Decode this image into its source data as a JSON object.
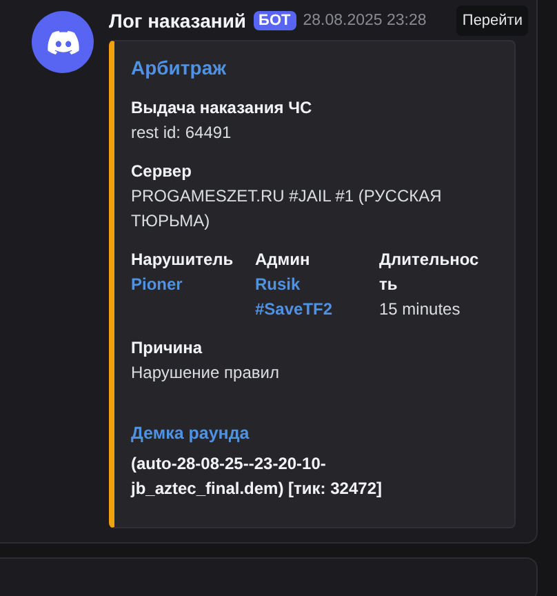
{
  "message": {
    "author": "Лог наказаний",
    "bot_tag": "БОТ",
    "timestamp": "28.08.2025 23:28",
    "jump_button": "Перейти",
    "embed": {
      "title": "Арбитраж",
      "fields": [
        {
          "kind": "plain",
          "name": "Выдача наказания ЧС",
          "value": "rest id: 64491",
          "inline": false
        },
        {
          "kind": "plain",
          "name": "Сервер",
          "value": "PROGAMESZET.RU #JAIL #1 (РУССКАЯ ТЮРЬМА)",
          "inline": false
        },
        {
          "kind": "mention",
          "name": "Нарушитель",
          "value": "Pioner",
          "inline": true
        },
        {
          "kind": "mention",
          "name": "Админ",
          "value": "Rusik #SaveTF2",
          "inline": true
        },
        {
          "kind": "plain",
          "name": "Длительность",
          "value": "15 minutes",
          "inline": true
        },
        {
          "kind": "plain",
          "name": "Причина",
          "value": "Нарушение правил",
          "inline": false
        },
        {
          "kind": "demo",
          "name": "Демка раунда",
          "value": "(auto-28-08-25--23-20-10-jb_aztec_final.dem) [тик: 32472]",
          "inline": false
        }
      ]
    }
  }
}
